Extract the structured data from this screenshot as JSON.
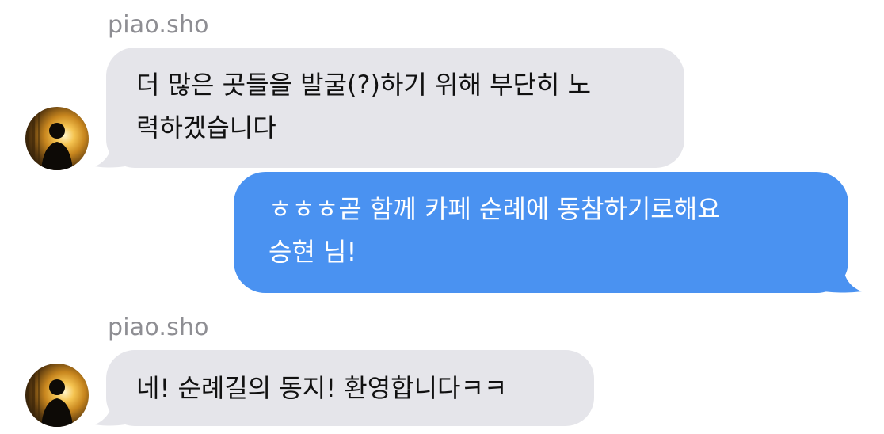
{
  "thread": {
    "messages": [
      {
        "direction": "incoming",
        "sender": "piao.sho",
        "lines": [
          "더 많은 곳들을 발굴(?)하기 위해 부단히 노",
          "력하겠습니다"
        ]
      },
      {
        "direction": "outgoing",
        "lines": [
          "ㅎㅎㅎ곧 함께 카페 순례에 동참하기로해요",
          "승현 님!"
        ]
      },
      {
        "direction": "incoming",
        "sender": "piao.sho",
        "lines": [
          "네! 순례길의 동지! 환영합니다ㅋㅋ"
        ]
      }
    ]
  },
  "colors": {
    "incoming_bubble": "#e5e5ea",
    "outgoing_bubble": "#4a92f1",
    "sender_name": "#8e8e93"
  },
  "icons": {
    "avatar": "person-silhouette-avatar-icon"
  }
}
